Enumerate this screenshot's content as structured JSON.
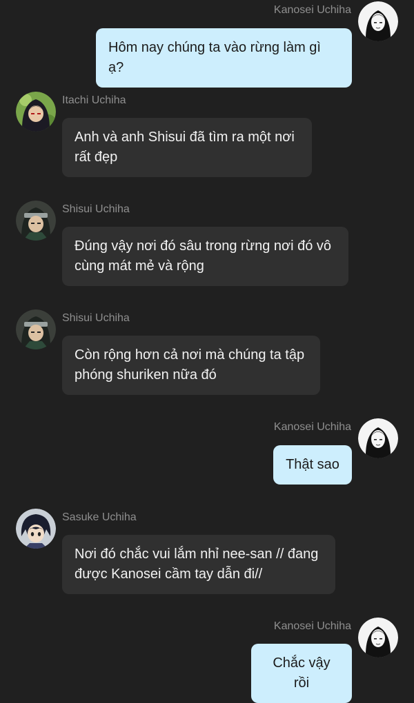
{
  "messages": [
    {
      "sender": "Kanosei Uchiha",
      "side": "right",
      "text": "Hôm nay chúng ta vào rừng làm gì ạ?",
      "avatar": "girl-avatar-icon"
    },
    {
      "sender": "Itachi Uchiha",
      "side": "left",
      "text": "Anh và anh Shisui đã tìm ra một nơi rất đẹp",
      "avatar": "itachi-avatar-icon"
    },
    {
      "sender": "Shisui Uchiha",
      "side": "left",
      "text": "Đúng vậy nơi đó sâu trong rừng nơi đó vô cùng mát mẻ và rộng",
      "avatar": "shisui-avatar-icon"
    },
    {
      "sender": "Shisui Uchiha",
      "side": "left",
      "text": "Còn rộng hơn cả nơi mà chúng ta tập phóng shuriken nữa đó",
      "avatar": "shisui-avatar-icon"
    },
    {
      "sender": "Kanosei Uchiha",
      "side": "right",
      "text": "Thật sao",
      "avatar": "girl-avatar-icon"
    },
    {
      "sender": "Sasuke Uchiha",
      "side": "left",
      "text": "Nơi đó chắc vui lắm nhỉ nee-san // đang được Kanosei cầm tay dẫn đi//",
      "avatar": "sasuke-avatar-icon"
    },
    {
      "sender": "Kanosei Uchiha",
      "side": "right",
      "text": "Chắc vậy rồi",
      "avatar": "girl-avatar-icon"
    }
  ],
  "colors": {
    "background": "#202020",
    "left_bubble": "#303030",
    "right_bubble": "#cdeefd",
    "name_text": "#8f8f8f"
  }
}
